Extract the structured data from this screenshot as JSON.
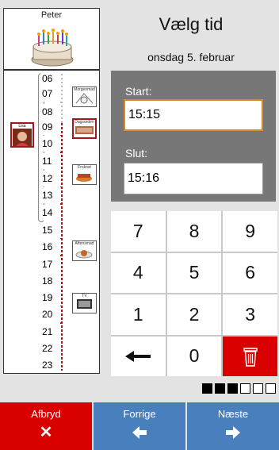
{
  "profile": {
    "name": "Peter"
  },
  "header": {
    "title": "Vælg tid",
    "date": "onsdag 5. februar"
  },
  "timeline": {
    "hours": [
      "06",
      "07",
      "08",
      "09",
      "10",
      "11",
      "12",
      "13",
      "14",
      "15",
      "16",
      "17",
      "18",
      "19",
      "20",
      "21",
      "22",
      "23"
    ],
    "person_caption": "Lisa",
    "pictograms": [
      {
        "caption": "Morgenmad"
      },
      {
        "caption": "Dagsorden"
      },
      {
        "caption": "Frokost"
      },
      {
        "caption": "Aftensmad"
      },
      {
        "caption": "TV"
      }
    ]
  },
  "time_panel": {
    "start_label": "Start:",
    "start_value": "15:15",
    "end_label": "Slut:",
    "end_value": "15:16"
  },
  "keypad": {
    "keys": [
      "7",
      "8",
      "9",
      "4",
      "5",
      "6",
      "1",
      "2",
      "3",
      "←",
      "0",
      ""
    ]
  },
  "progress": {
    "total_steps": 6,
    "completed_steps": 3
  },
  "nav": {
    "cancel_label": "Afbryd",
    "back_label": "Forrige",
    "next_label": "Næste"
  },
  "colors": {
    "cancel": "#d90000",
    "nav_blue": "#4a7fbe",
    "panel": "#777777",
    "active_field_border": "#d68a2e"
  }
}
